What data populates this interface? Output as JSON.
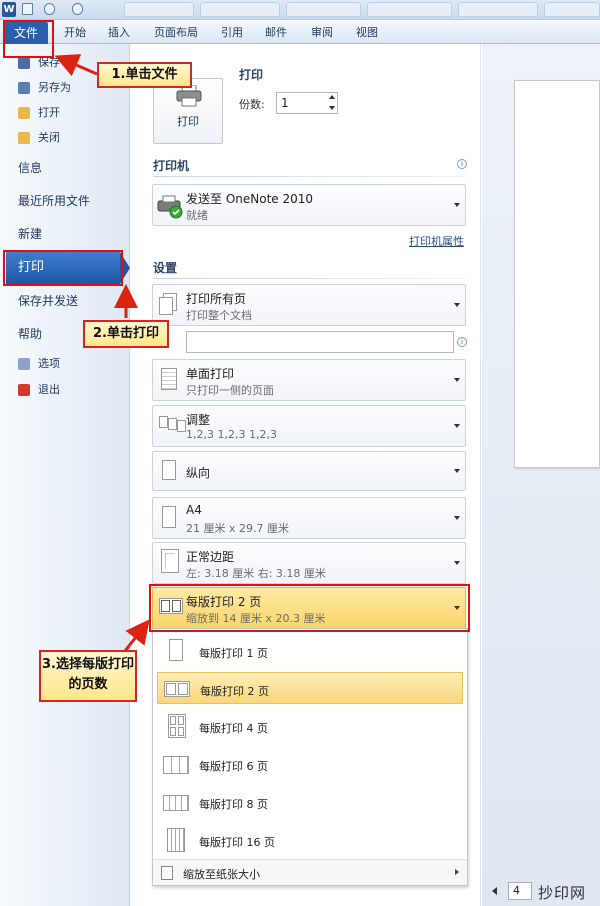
{
  "app": {
    "logo": "W"
  },
  "ribbon": {
    "file_tab": "文件",
    "tabs": [
      "开始",
      "插入",
      "页面布局",
      "引用",
      "邮件",
      "审阅",
      "视图"
    ]
  },
  "nav": {
    "small_top": [
      {
        "label": "保存",
        "icon": "save-icon"
      },
      {
        "label": "另存为",
        "icon": "save-as-icon"
      },
      {
        "label": "打开",
        "icon": "open-folder-icon"
      },
      {
        "label": "关闭",
        "icon": "close-folder-icon"
      }
    ],
    "info": "信息",
    "recent": "最近所用文件",
    "new": "新建",
    "print": "打印",
    "save_send": "保存并发送",
    "help": "帮助",
    "options": "选项",
    "exit": "退出"
  },
  "print": {
    "title": "打印",
    "button": "打印",
    "copies_label": "份数:",
    "copies_value": "1"
  },
  "printer": {
    "section": "打印机",
    "name": "发送至 OneNote 2010",
    "status": "就绪",
    "properties_link": "打印机属性"
  },
  "settings": {
    "section": "设置",
    "pages_input_placeholder": "",
    "items": [
      {
        "id": "print-range",
        "l1": "打印所有页",
        "l2": "打印整个文档"
      },
      {
        "id": "sides",
        "l1": "单面打印",
        "l2": "只打印一侧的页面"
      },
      {
        "id": "collate",
        "l1": "调整",
        "l2": "1,2,3     1,2,3     1,2,3"
      },
      {
        "id": "orientation",
        "l1": "纵向",
        "l2": ""
      },
      {
        "id": "paper-size",
        "l1": "A4",
        "l2": "21 厘米 x 29.7 厘米"
      },
      {
        "id": "margins",
        "l1": "正常边距",
        "l2": "左:  3.18 厘米     右:  3.18 厘米"
      },
      {
        "id": "pages-per-sheet",
        "l1": "每版打印 2 页",
        "l2": "缩放到 14 厘米 x 20.3 厘米"
      }
    ]
  },
  "menu": {
    "items": [
      "每版打印 1 页",
      "每版打印 2 页",
      "每版打印 4 页",
      "每版打印 6 页",
      "每版打印 8 页",
      "每版打印 16 页"
    ],
    "selected": "每版打印 2 页",
    "footer": "缩放至纸张大小"
  },
  "preview": {
    "page_number": "4"
  },
  "annotations": {
    "step1": "1.单击文件",
    "step2": "2.单击打印",
    "step3": "3.选择每版打印的页数",
    "colors": {
      "highlight_border": "#e01010",
      "callout_bg": "#ffe68a"
    }
  },
  "watermark": "抄印网",
  "colors": {
    "file_tab": "#2a5fb0",
    "selected_item": "#f9d779",
    "nav_selected": "#1f56a5"
  }
}
